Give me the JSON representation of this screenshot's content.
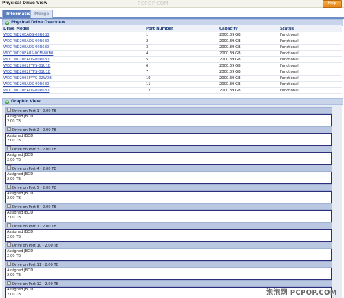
{
  "window": {
    "title": "Physical Drive View",
    "help_label": "Help",
    "watermark_top": "PCPOP.COM"
  },
  "tabs": [
    {
      "label": "Information",
      "active": true
    },
    {
      "label": "Merge",
      "active": false
    }
  ],
  "overview": {
    "title": "Physical Drive Overview",
    "columns": [
      "Drive Model",
      "Port Number",
      "Capacity",
      "Status"
    ],
    "rows": [
      {
        "model": "WDC WD20EADS-00R6B0",
        "port": "1",
        "capacity": "2000.39 GB",
        "status": "Functional"
      },
      {
        "model": "WDC WD20EADS-00R6B0",
        "port": "2",
        "capacity": "2000.39 GB",
        "status": "Functional"
      },
      {
        "model": "WDC WD20EADS-00R6B0",
        "port": "3",
        "capacity": "2000.39 GB",
        "status": "Functional"
      },
      {
        "model": "WDC WD20EARS-00MVWB0",
        "port": "4",
        "capacity": "2000.39 GB",
        "status": "Functional"
      },
      {
        "model": "WDC WD20EADS-00R6B0",
        "port": "5",
        "capacity": "2000.39 GB",
        "status": "Functional"
      },
      {
        "model": "WDC WD2002FYPS-01U1B",
        "port": "6",
        "capacity": "2000.39 GB",
        "status": "Functional"
      },
      {
        "model": "WDC WD2002FYPS-01U1B",
        "port": "7",
        "capacity": "2000.39 GB",
        "status": "Functional"
      },
      {
        "model": "WDC WD2003FYYS-02W0B",
        "port": "10",
        "capacity": "2000.39 GB",
        "status": "Functional"
      },
      {
        "model": "WDC WD20EADS-00R6B0",
        "port": "11",
        "capacity": "2000.39 GB",
        "status": "Functional"
      },
      {
        "model": "WDC WD20EADS-00R6B0",
        "port": "12",
        "capacity": "2000.39 GB",
        "status": "Functional"
      }
    ]
  },
  "graphic": {
    "title": "Graphic View",
    "drives": [
      {
        "header": "Drive on Port 1 - 2.00 TB",
        "assignment": "Assigned JBOD",
        "size": "2.00 TB"
      },
      {
        "header": "Drive on Port 2 - 2.00 TB",
        "assignment": "Assigned JBOD",
        "size": "2.00 TB"
      },
      {
        "header": "Drive on Port 3 - 2.00 TB",
        "assignment": "Assigned JBOD",
        "size": "2.00 TB"
      },
      {
        "header": "Drive on Port 4 - 2.00 TB",
        "assignment": "Assigned JBOD",
        "size": "2.00 TB"
      },
      {
        "header": "Drive on Port 5 - 2.00 TB",
        "assignment": "Assigned JBOD",
        "size": "2.00 TB"
      },
      {
        "header": "Drive on Port 6 - 2.00 TB",
        "assignment": "Assigned JBOD",
        "size": "2.00 TB"
      },
      {
        "header": "Drive on Port 7 - 2.00 TB",
        "assignment": "Assigned JBOD",
        "size": "2.00 TB"
      },
      {
        "header": "Drive on Port 10 - 2.00 TB",
        "assignment": "Assigned JBOD",
        "size": "2.00 TB"
      },
      {
        "header": "Drive on Port 11 - 2.00 TB",
        "assignment": "Assigned JBOD",
        "size": "2.00 TB"
      },
      {
        "header": "Drive on Port 12 - 2.00 TB",
        "assignment": "Assigned JBOD",
        "size": "2.00 TB"
      }
    ]
  },
  "watermark_bottom": "泡泡网 PCPOP.COM",
  "colors": {
    "accent": "#5b7fbf",
    "help": "#e8891a",
    "link": "#2a48b0",
    "section": "#c9d5ea"
  }
}
